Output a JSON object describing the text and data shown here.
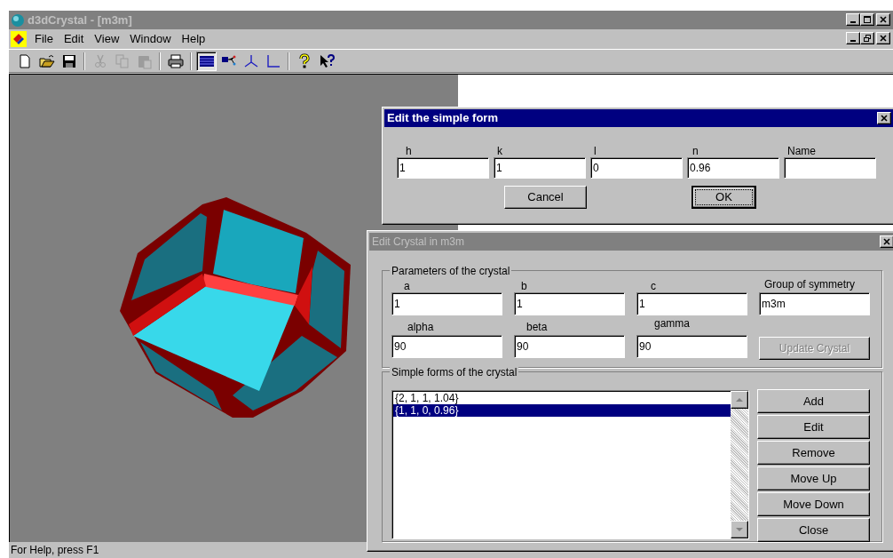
{
  "app": {
    "title": "d3dCrystal - [m3m]",
    "active": false,
    "menu": [
      "File",
      "Edit",
      "View",
      "Window",
      "Help"
    ],
    "toolbar": [
      {
        "kind": "new",
        "disabled": false,
        "pressed": false
      },
      {
        "kind": "open",
        "disabled": false,
        "pressed": false
      },
      {
        "kind": "save",
        "disabled": false,
        "pressed": false
      },
      {
        "kind": "separator"
      },
      {
        "kind": "cut",
        "disabled": true,
        "pressed": false
      },
      {
        "kind": "copy",
        "disabled": true,
        "pressed": false
      },
      {
        "kind": "paste",
        "disabled": true,
        "pressed": false
      },
      {
        "kind": "separator"
      },
      {
        "kind": "print",
        "disabled": false,
        "pressed": false
      },
      {
        "kind": "separator"
      },
      {
        "kind": "grid",
        "disabled": false,
        "pressed": true
      },
      {
        "kind": "node",
        "disabled": false,
        "pressed": false
      },
      {
        "kind": "axes",
        "disabled": false,
        "pressed": false
      },
      {
        "kind": "corner",
        "disabled": false,
        "pressed": false
      },
      {
        "kind": "separator"
      },
      {
        "kind": "help",
        "disabled": false,
        "pressed": false
      },
      {
        "kind": "context-help",
        "disabled": false,
        "pressed": false
      }
    ],
    "status_bar": "For Help, press F1"
  },
  "simple_form_dialog": {
    "title": "Edit the simple form",
    "active": true,
    "fields": [
      {
        "label": "h",
        "value": "1"
      },
      {
        "label": "k",
        "value": "1"
      },
      {
        "label": "l",
        "value": "0"
      },
      {
        "label": "n",
        "value": "0.96"
      },
      {
        "label": "Name"
      }
    ],
    "buttons": [
      {
        "label": "Cancel",
        "default": false
      },
      {
        "label": "OK",
        "default": true
      }
    ]
  },
  "crystal_dialog": {
    "title": "Edit Crystal in m3m",
    "active": false,
    "parameters_group": "Parameters of the crystal",
    "fields": [
      {
        "label": "a",
        "value": "1"
      },
      {
        "label": "b",
        "value": "1"
      },
      {
        "label": "c",
        "value": "1"
      },
      {
        "label": "Group of symmetry",
        "value": "m3m"
      },
      {
        "label": "alpha",
        "value": "90"
      },
      {
        "label": "beta",
        "value": "90"
      },
      {
        "label": "gamma",
        "value": "90"
      }
    ],
    "update_button": {
      "label": "Update Crystal",
      "disabled": true
    },
    "forms_group": "Simple forms of the crystal",
    "forms": [
      {
        "text": "{2, 1, 1, 1.04}",
        "selected": false
      },
      {
        "text": "{1, 1, 0, 0.96}",
        "selected": true
      }
    ],
    "buttons": [
      "Add",
      "Edit",
      "Remove",
      "Move Up",
      "Move Down",
      "Close"
    ]
  }
}
